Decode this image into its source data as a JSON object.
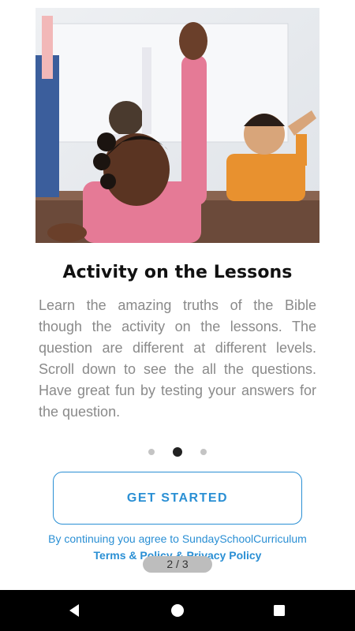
{
  "hero": {
    "image_desc": "classroom-children-raising-hands-photo"
  },
  "slide": {
    "title": "Activity on the Lessons",
    "description": "Learn the amazing truths of the Bible though the activity on the lessons. The question are different at different levels. Scroll down to see the all the questions. Have great fun by testing your answers for the question."
  },
  "pagination": {
    "count": 3,
    "active_index": 1
  },
  "cta": {
    "label": "GET STARTED"
  },
  "consent": {
    "line1": "By continuing you agree to SundaySchoolCurriculum",
    "line2": "Terms & Policy & Privacy Policy"
  },
  "page_indicator": {
    "text": "2 / 3"
  },
  "colors": {
    "accent": "#2a8fd4",
    "title": "#111111",
    "body": "#8a8a8a",
    "dot_active": "#222222",
    "dot_inactive": "#c4c4c4"
  },
  "navbar": {
    "back": "back-icon",
    "home": "home-icon",
    "recents": "recents-icon"
  }
}
